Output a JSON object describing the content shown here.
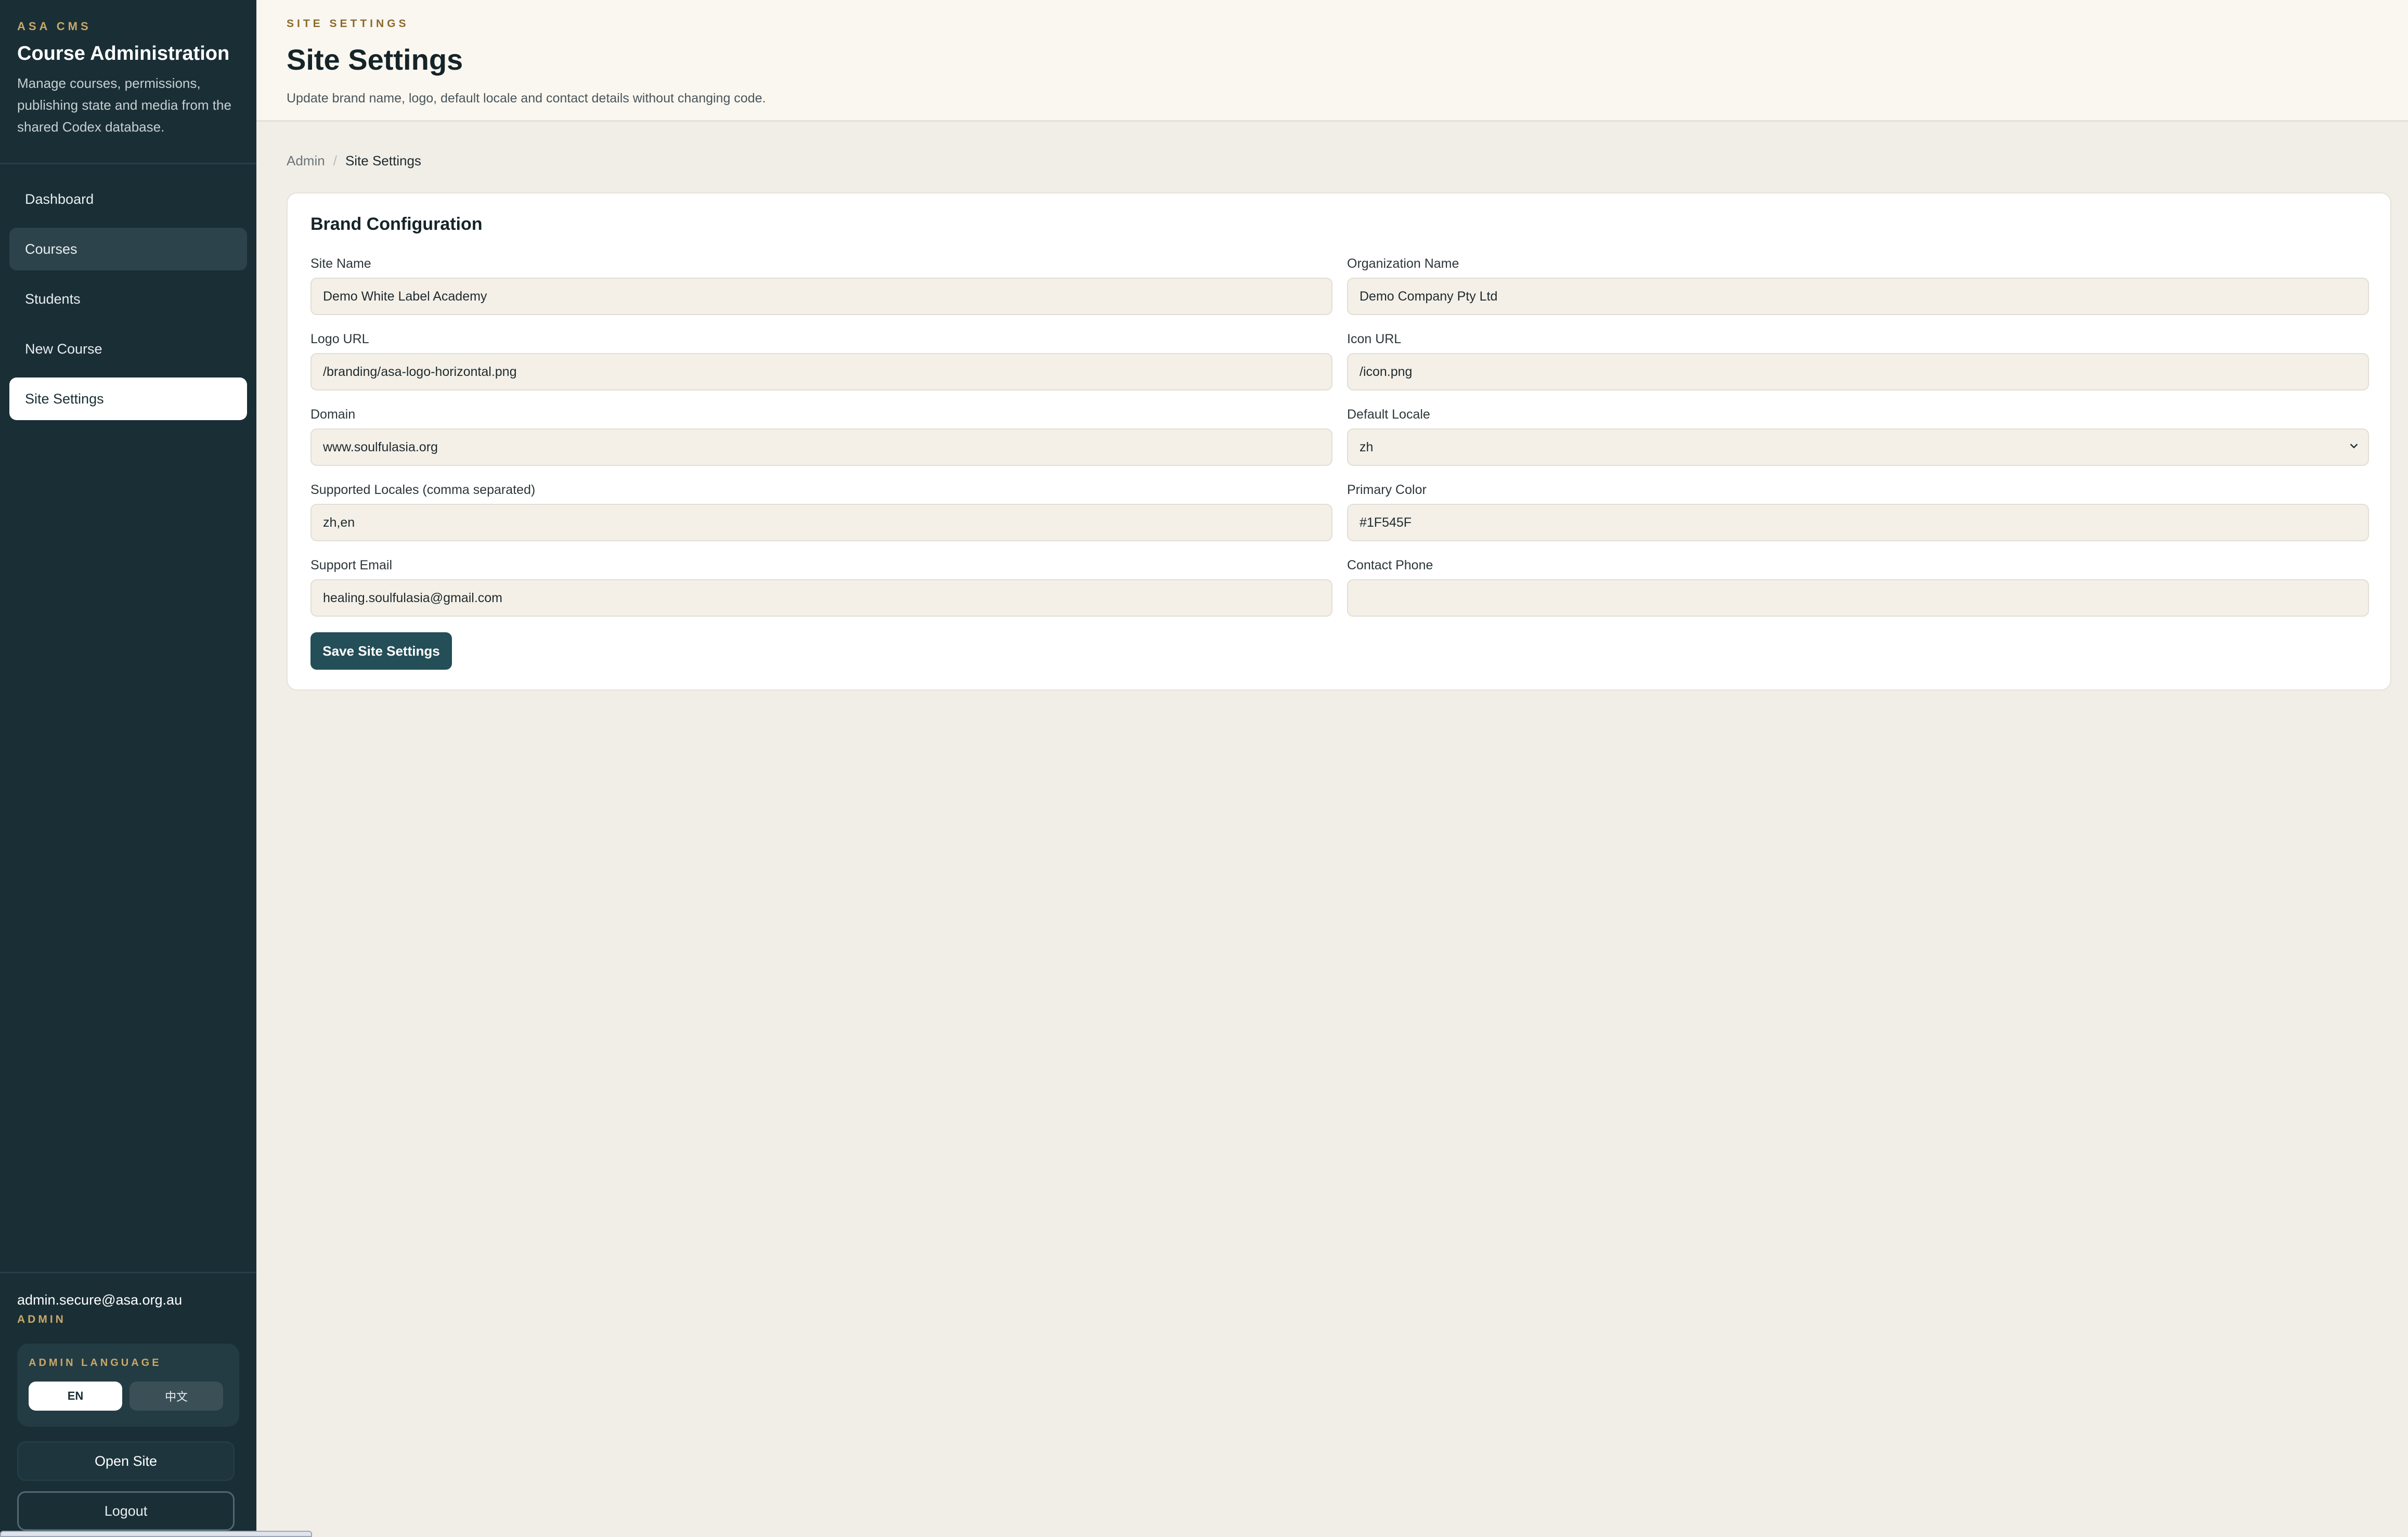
{
  "sidebar": {
    "eyebrow": "ASA CMS",
    "title": "Course Administration",
    "description": "Manage courses, permissions, publishing state and media from the shared Codex database.",
    "items": [
      {
        "label": "Dashboard"
      },
      {
        "label": "Courses"
      },
      {
        "label": "Students"
      },
      {
        "label": "New Course"
      },
      {
        "label": "Site Settings"
      }
    ],
    "user_email": "admin.secure@asa.org.au",
    "user_role": "ADMIN",
    "language": {
      "label": "ADMIN LANGUAGE",
      "options": [
        "EN",
        "中文"
      ],
      "selected": "EN"
    },
    "open_site_label": "Open Site",
    "logout_label": "Logout"
  },
  "header": {
    "eyebrow": "SITE SETTINGS",
    "title": "Site Settings",
    "subtitle": "Update brand name, logo, default locale and contact details without changing code."
  },
  "breadcrumb": {
    "root": "Admin",
    "separator": "/",
    "current": "Site Settings"
  },
  "form": {
    "title": "Brand Configuration",
    "fields": {
      "site_name": {
        "label": "Site Name",
        "value": "Demo White Label Academy"
      },
      "organization_name": {
        "label": "Organization Name",
        "value": "Demo Company Pty Ltd"
      },
      "logo_url": {
        "label": "Logo URL",
        "value": "/branding/asa-logo-horizontal.png"
      },
      "icon_url": {
        "label": "Icon URL",
        "value": "/icon.png"
      },
      "domain": {
        "label": "Domain",
        "value": "www.soulfulasia.org"
      },
      "default_locale": {
        "label": "Default Locale",
        "value": "zh"
      },
      "supported_locales": {
        "label": "Supported Locales (comma separated)",
        "value": "zh,en"
      },
      "primary_color": {
        "label": "Primary Color",
        "value": "#1F545F"
      },
      "support_email": {
        "label": "Support Email",
        "value": "healing.soulfulasia@gmail.com"
      },
      "contact_phone": {
        "label": "Contact Phone",
        "value": ""
      }
    },
    "save_label": "Save Site Settings"
  },
  "icons": {
    "select": "chevron-down-icon"
  },
  "colors": {
    "sidebar_bg": "#1a2e35",
    "accent_gold": "#c8a96a",
    "primary_button": "#244e58",
    "page_bg": "#f1eee7"
  }
}
